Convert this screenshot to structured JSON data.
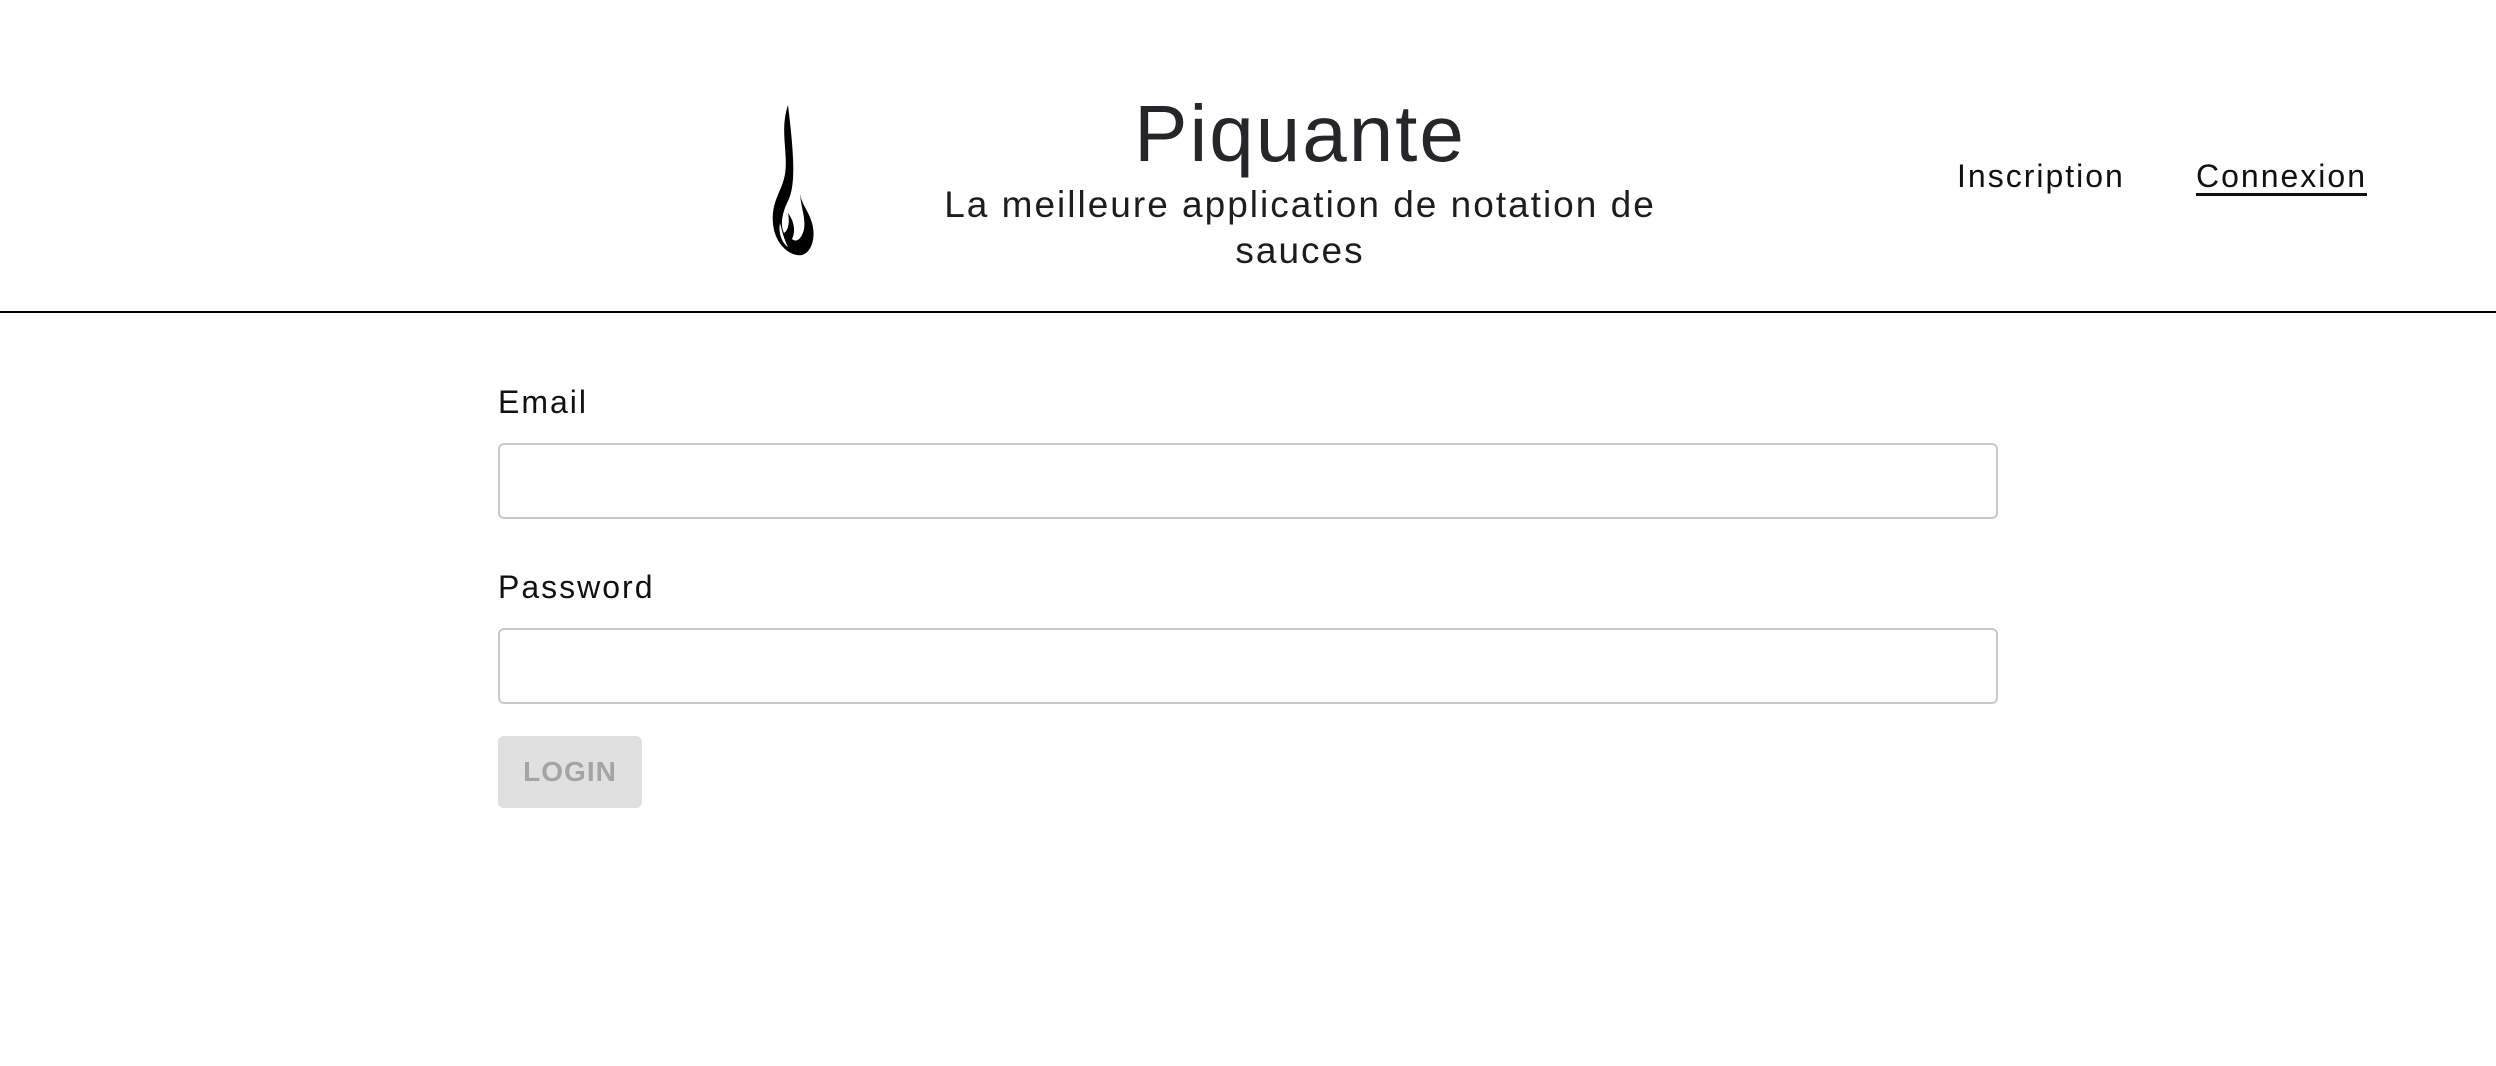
{
  "header": {
    "logo_icon": "flame-icon",
    "title": "Piquante",
    "subtitle": "La meilleure application de notation de sauces"
  },
  "nav": {
    "signup_label": "Inscription",
    "login_label": "Connexion"
  },
  "form": {
    "email_label": "Email",
    "email_value": "",
    "password_label": "Password",
    "password_value": "",
    "submit_label": "LOGIN",
    "submit_state": "disabled"
  },
  "colors": {
    "header_border": "#000000",
    "button_bg_disabled": "#e0e0e0",
    "button_text_disabled": "#a4a4a4",
    "input_border": "#c9c9c9"
  }
}
